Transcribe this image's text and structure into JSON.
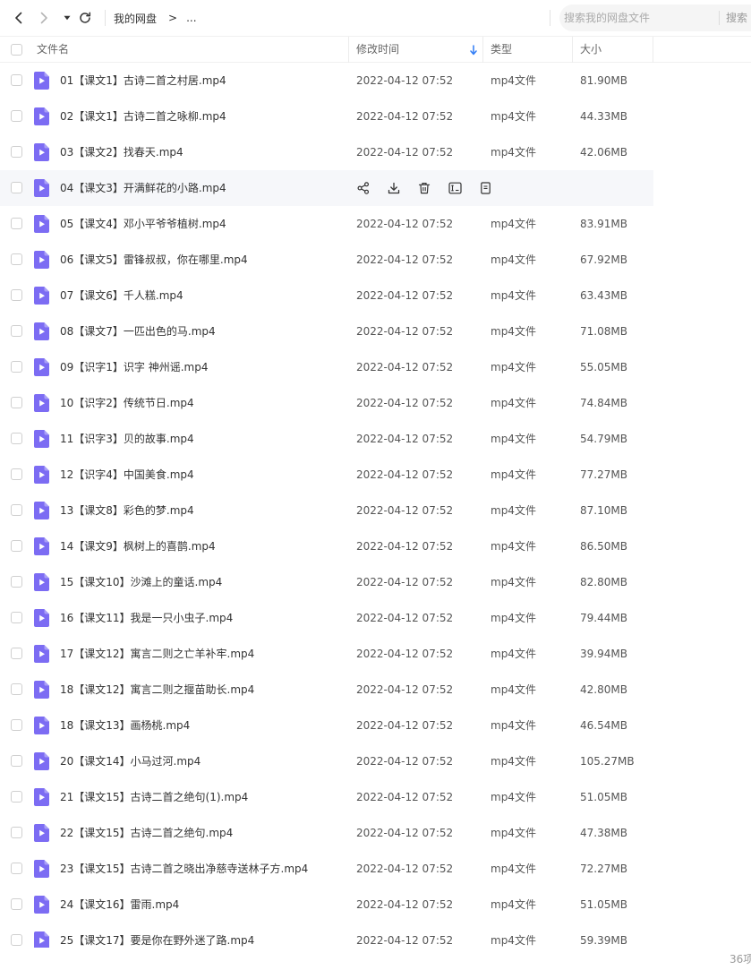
{
  "nav": {
    "back_icon": "chevron-left-icon",
    "forward_icon": "chevron-right-icon",
    "history_icon": "caret-down-icon",
    "refresh_icon": "refresh-icon",
    "breadcrumb_root": "我的网盘",
    "breadcrumb_separator": ">",
    "breadcrumb_more": "..."
  },
  "search": {
    "placeholder": "搜索我的网盘文件",
    "button_label": "搜索"
  },
  "columns": {
    "name": "文件名",
    "modified": "修改时间",
    "type": "类型",
    "size": "大小"
  },
  "colors": {
    "file_icon": "#7c6cf3",
    "sort_arrow": "#2f7cf6",
    "hover_row": "#f6f7fa"
  },
  "hover_row_index": 3,
  "hover_actions": [
    "share-icon",
    "download-icon",
    "delete-icon",
    "rename-icon",
    "more-icon"
  ],
  "files": [
    {
      "name": "01【课文1】古诗二首之村居.mp4",
      "time": "2022-04-12 07:52",
      "type": "mp4文件",
      "size": "81.90MB"
    },
    {
      "name": "02【课文1】古诗二首之咏柳.mp4",
      "time": "2022-04-12 07:52",
      "type": "mp4文件",
      "size": "44.33MB"
    },
    {
      "name": "03【课文2】找春天.mp4",
      "time": "2022-04-12 07:52",
      "type": "mp4文件",
      "size": "42.06MB"
    },
    {
      "name": "04【课文3】开满鲜花的小路.mp4",
      "time": "",
      "type": "",
      "size": ""
    },
    {
      "name": "05【课文4】邓小平爷爷植树.mp4",
      "time": "2022-04-12 07:52",
      "type": "mp4文件",
      "size": "83.91MB"
    },
    {
      "name": "06【课文5】雷锋叔叔，你在哪里.mp4",
      "time": "2022-04-12 07:52",
      "type": "mp4文件",
      "size": "67.92MB"
    },
    {
      "name": "07【课文6】千人糕.mp4",
      "time": "2022-04-12 07:52",
      "type": "mp4文件",
      "size": "63.43MB"
    },
    {
      "name": "08【课文7】一匹出色的马.mp4",
      "time": "2022-04-12 07:52",
      "type": "mp4文件",
      "size": "71.08MB"
    },
    {
      "name": "09【识字1】识字 神州谣.mp4",
      "time": "2022-04-12 07:52",
      "type": "mp4文件",
      "size": "55.05MB"
    },
    {
      "name": "10【识字2】传统节日.mp4",
      "time": "2022-04-12 07:52",
      "type": "mp4文件",
      "size": "74.84MB"
    },
    {
      "name": "11【识字3】贝的故事.mp4",
      "time": "2022-04-12 07:52",
      "type": "mp4文件",
      "size": "54.79MB"
    },
    {
      "name": "12【识字4】中国美食.mp4",
      "time": "2022-04-12 07:52",
      "type": "mp4文件",
      "size": "77.27MB"
    },
    {
      "name": "13【课文8】彩色的梦.mp4",
      "time": "2022-04-12 07:52",
      "type": "mp4文件",
      "size": "87.10MB"
    },
    {
      "name": "14【课文9】枫树上的喜鹊.mp4",
      "time": "2022-04-12 07:52",
      "type": "mp4文件",
      "size": "86.50MB"
    },
    {
      "name": "15【课文10】沙滩上的童话.mp4",
      "time": "2022-04-12 07:52",
      "type": "mp4文件",
      "size": "82.80MB"
    },
    {
      "name": "16【课文11】我是一只小虫子.mp4",
      "time": "2022-04-12 07:52",
      "type": "mp4文件",
      "size": "79.44MB"
    },
    {
      "name": "17【课文12】寓言二则之亡羊补牢.mp4",
      "time": "2022-04-12 07:52",
      "type": "mp4文件",
      "size": "39.94MB"
    },
    {
      "name": "18【课文12】寓言二则之揠苗助长.mp4",
      "time": "2022-04-12 07:52",
      "type": "mp4文件",
      "size": "42.80MB"
    },
    {
      "name": "18【课文13】画杨桃.mp4",
      "time": "2022-04-12 07:52",
      "type": "mp4文件",
      "size": "46.54MB"
    },
    {
      "name": "20【课文14】小马过河.mp4",
      "time": "2022-04-12 07:52",
      "type": "mp4文件",
      "size": "105.27MB"
    },
    {
      "name": "21【课文15】古诗二首之绝句(1).mp4",
      "time": "2022-04-12 07:52",
      "type": "mp4文件",
      "size": "51.05MB"
    },
    {
      "name": "22【课文15】古诗二首之绝句.mp4",
      "time": "2022-04-12 07:52",
      "type": "mp4文件",
      "size": "47.38MB"
    },
    {
      "name": "23【课文15】古诗二首之晓出净慈寺送林子方.mp4",
      "time": "2022-04-12 07:52",
      "type": "mp4文件",
      "size": "72.27MB"
    },
    {
      "name": "24【课文16】雷雨.mp4",
      "time": "2022-04-12 07:52",
      "type": "mp4文件",
      "size": "51.05MB"
    },
    {
      "name": "25【课文17】要是你在野外迷了路.mp4",
      "time": "2022-04-12 07:52",
      "type": "mp4文件",
      "size": "59.39MB"
    }
  ],
  "footer": {
    "count": "36项"
  }
}
